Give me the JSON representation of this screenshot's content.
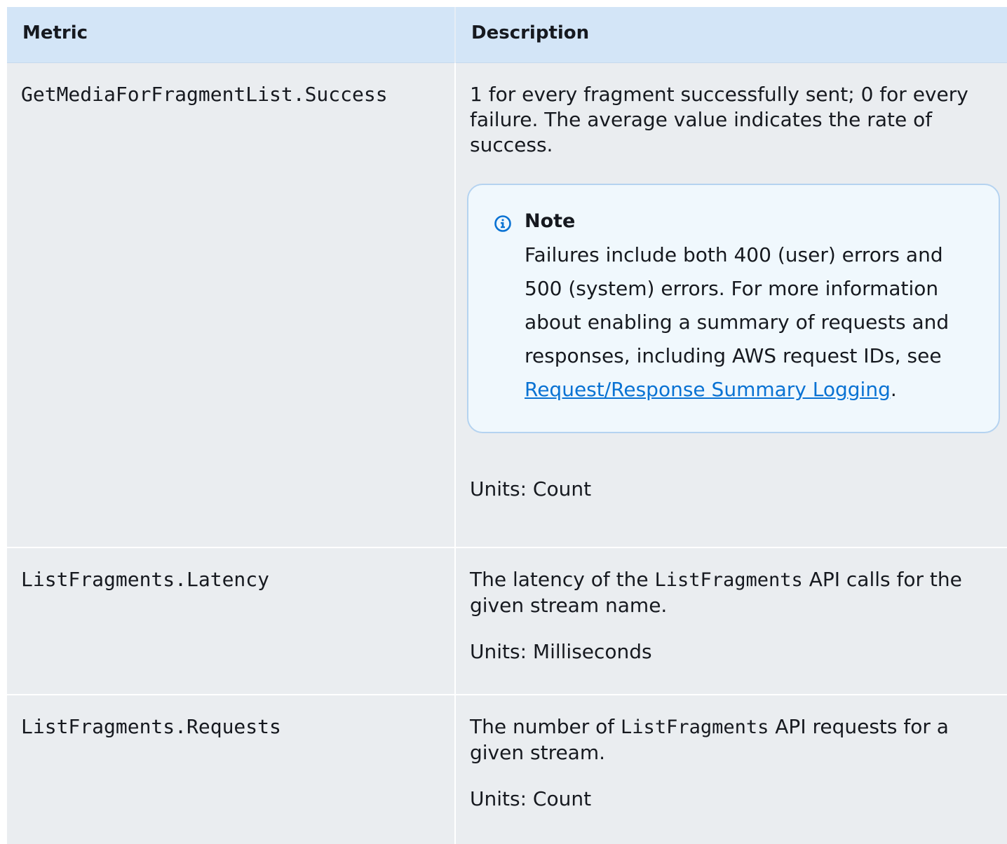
{
  "table": {
    "headers": {
      "metric": "Metric",
      "description": "Description"
    },
    "rows": [
      {
        "metric": "GetMediaForFragmentList.Success",
        "description": "1 for every fragment successfully sent; 0 for every failure. The average value indicates the rate of success.",
        "note": {
          "title": "Note",
          "body": "Failures include both 400 (user) errors and 500 (system) errors. For more information about enabling a summary of requests and responses, including AWS request IDs, see ",
          "link_text": "Request/Response Summary Logging",
          "trailing": "."
        },
        "units": "Units: Count"
      },
      {
        "metric": "ListFragments.Latency",
        "desc_prefix": "The latency of the ",
        "desc_code": "ListFragments",
        "desc_suffix": " API calls for the given stream name.",
        "units": "Units: Milliseconds"
      },
      {
        "metric": "ListFragments.Requests",
        "desc_prefix": "The number of ",
        "desc_code": "ListFragments",
        "desc_suffix": " API requests for a given stream.",
        "units": "Units: Count"
      }
    ]
  },
  "icons": {
    "note": "info-icon",
    "note_color": "#0972d3"
  }
}
